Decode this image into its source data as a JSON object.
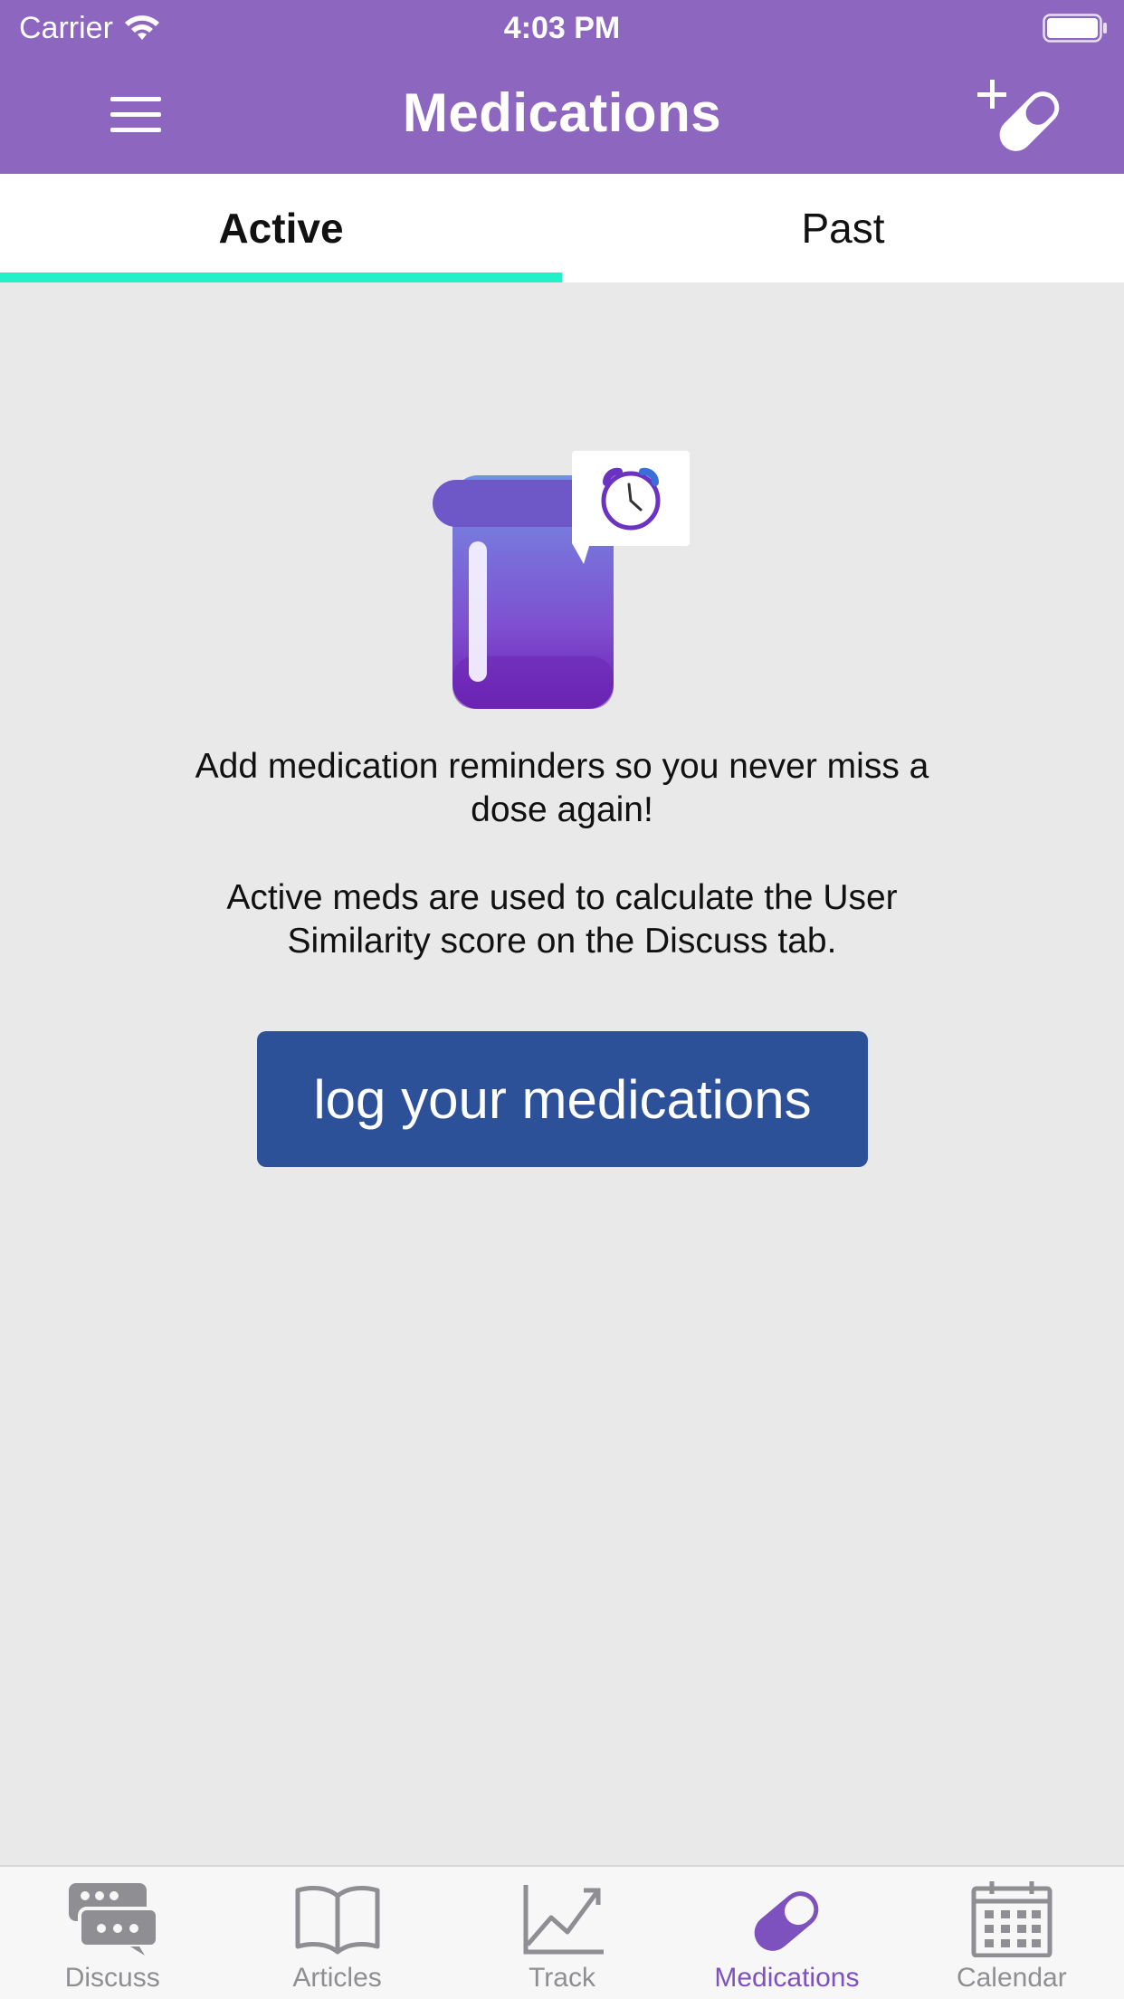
{
  "status_bar": {
    "carrier": "Carrier",
    "time": "4:03 PM"
  },
  "header": {
    "title": "Medications"
  },
  "tabs": [
    {
      "label": "Active",
      "selected": true
    },
    {
      "label": "Past",
      "selected": false
    }
  ],
  "empty_state": {
    "message_1": "Add medication reminders so you never miss a dose again!",
    "message_2": "Active meds are used to calculate the User Similarity score on the Discuss tab.",
    "cta_label": "log your medications"
  },
  "tab_bar": [
    {
      "label": "Discuss",
      "icon": "discuss-icon"
    },
    {
      "label": "Articles",
      "icon": "book-icon"
    },
    {
      "label": "Track",
      "icon": "chart-icon"
    },
    {
      "label": "Medications",
      "icon": "pill-icon",
      "selected": true
    },
    {
      "label": "Calendar",
      "icon": "calendar-icon"
    }
  ],
  "colors": {
    "header": "#8c66bf",
    "tab_indicator": "#22f0c8",
    "cta": "#2d5199",
    "tabbar_selected": "#7d52bf",
    "tabbar_inactive": "#8e8e93"
  }
}
